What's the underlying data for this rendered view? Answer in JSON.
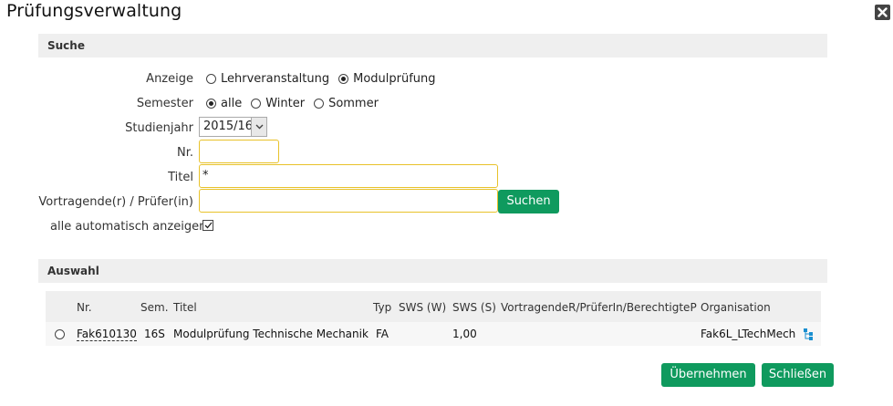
{
  "window": {
    "title": "Prüfungsverwaltung"
  },
  "search": {
    "section_title": "Suche",
    "anzeige_label": "Anzeige",
    "anzeige_options": [
      "Lehrveranstaltung",
      "Modulprüfung"
    ],
    "anzeige_selected": "Modulprüfung",
    "semester_label": "Semester",
    "semester_options": [
      "alle",
      "Winter",
      "Sommer"
    ],
    "semester_selected": "alle",
    "studienjahr_label": "Studienjahr",
    "studienjahr_value": "2015/16",
    "nr_label": "Nr.",
    "nr_value": "",
    "titel_label": "Titel",
    "titel_value": "*",
    "vortragende_label": "Vortragende(r) / Prüfer(in)",
    "vortragende_value": "",
    "search_button": "Suchen",
    "auto_label": "alle automatisch anzeigen",
    "auto_checked": true
  },
  "results": {
    "section_title": "Auswahl",
    "columns": {
      "nr": "Nr.",
      "sem": "Sem.",
      "titel": "Titel",
      "typ": "Typ",
      "sws_w": "SWS (W)",
      "sws_s": "SWS (S)",
      "vortragende": "VortragendeR/PrüferIn/BerechtigteP",
      "organisation": "Organisation"
    },
    "rows": [
      {
        "nr": "Fak610130",
        "sem": "16S",
        "titel": "Modulprüfung Technische Mechanik",
        "typ": "FA",
        "sws_w": "",
        "sws_s": "1,00",
        "vortragende": "",
        "organisation": "Fak6L_LTechMech"
      }
    ]
  },
  "footer": {
    "accept_button": "Übernehmen",
    "close_button": "Schließen"
  },
  "colors": {
    "accent": "#0f9a5e",
    "input_border": "#e8c22a",
    "section_bg": "#efefef"
  }
}
